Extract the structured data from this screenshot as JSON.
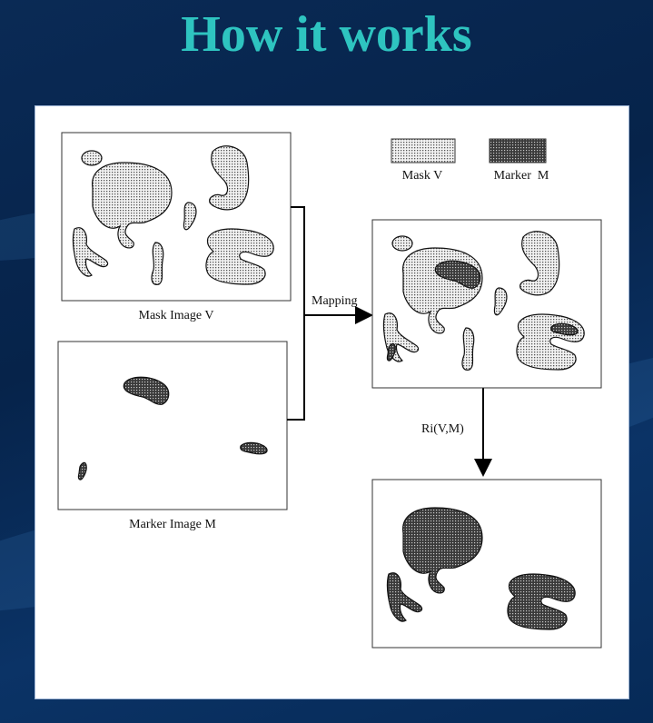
{
  "slide": {
    "title": "How it works"
  },
  "diagram": {
    "mask_label": "Mask Image V",
    "marker_label": "Marker Image M",
    "mapping_label": "Mapping",
    "ri_label": "Ri(V,M)",
    "legend": {
      "mask": "Mask V",
      "marker": "Marker  M"
    }
  }
}
